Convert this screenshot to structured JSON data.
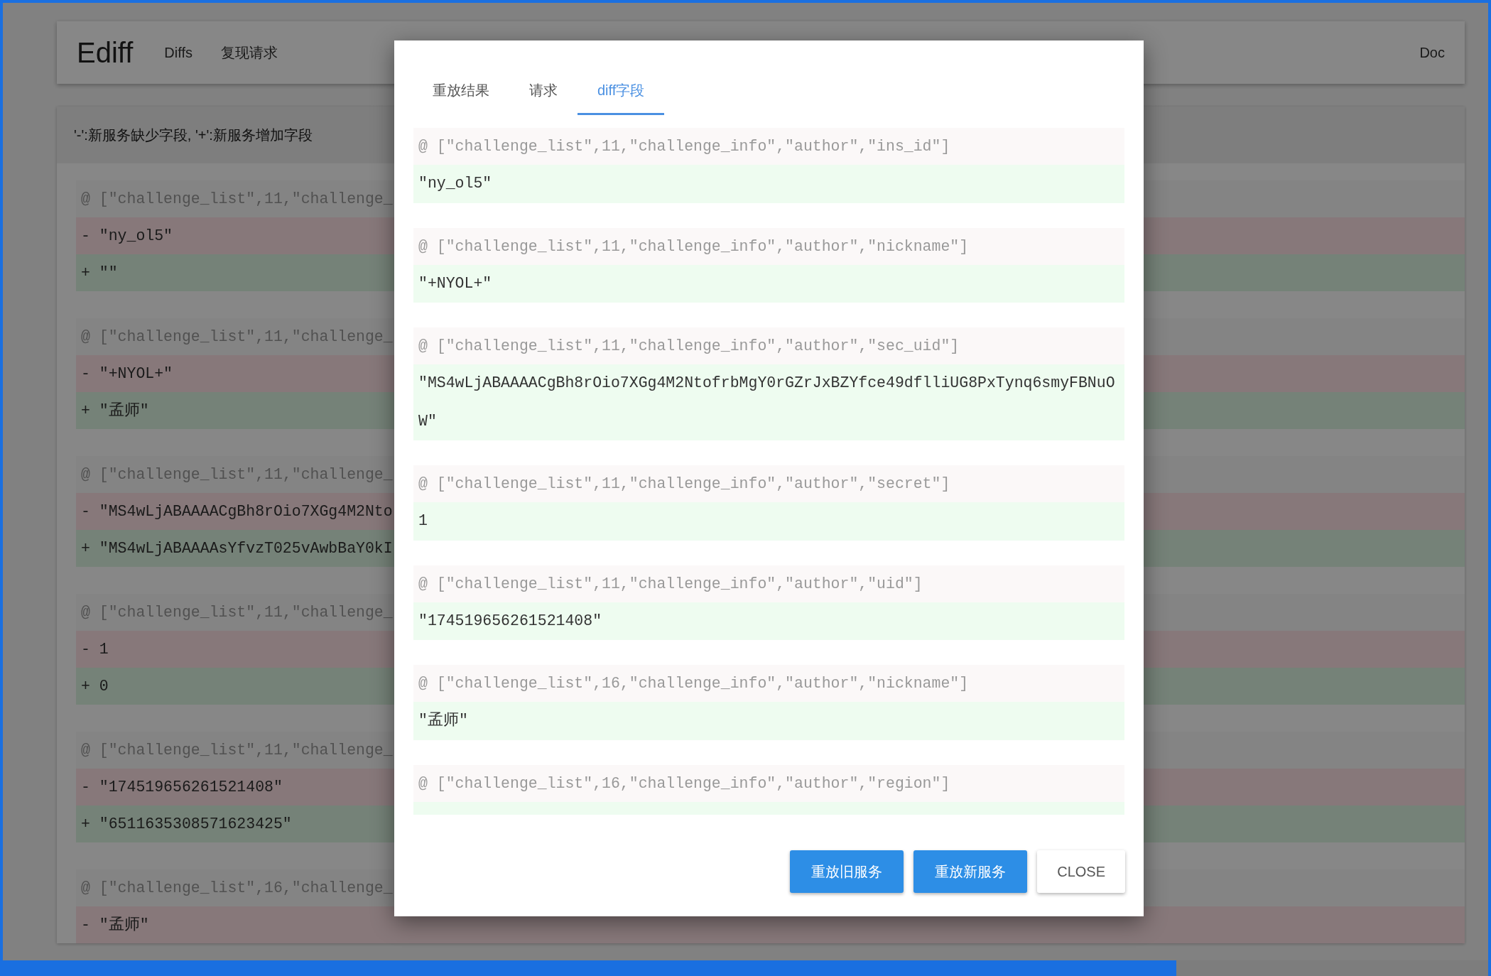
{
  "app": {
    "brand": "Ediff",
    "nav": [
      "Diffs",
      "复现请求"
    ],
    "doc_link": "Doc"
  },
  "legend": "'-':新服务缺少字段, '+':新服务增加字段",
  "diffs": [
    {
      "lines": [
        {
          "kind": "path",
          "text": "@ [\"challenge_list\",11,\"challenge_"
        },
        {
          "kind": "removed",
          "text": "- \"ny_ol5\""
        },
        {
          "kind": "added",
          "text": "+ \"\""
        }
      ]
    },
    {
      "lines": [
        {
          "kind": "path",
          "text": "@ [\"challenge_list\",11,\"challenge_"
        },
        {
          "kind": "removed",
          "text": "- \"+NYOL+\""
        },
        {
          "kind": "added",
          "text": "+ \"孟师\""
        }
      ]
    },
    {
      "lines": [
        {
          "kind": "path",
          "text": "@ [\"challenge_list\",11,\"challenge_"
        },
        {
          "kind": "removed",
          "text": "- \"MS4wLjABAAAACgBh8rOio7XGg4M2Nto"
        },
        {
          "kind": "added",
          "text": "+ \"MS4wLjABAAAAsYfvzT025vAwbBaY0kI"
        }
      ]
    },
    {
      "lines": [
        {
          "kind": "path",
          "text": "@ [\"challenge_list\",11,\"challenge_"
        },
        {
          "kind": "removed",
          "text": "- 1"
        },
        {
          "kind": "added",
          "text": "+ 0"
        }
      ]
    },
    {
      "lines": [
        {
          "kind": "path",
          "text": "@ [\"challenge_list\",11,\"challenge_"
        },
        {
          "kind": "removed",
          "text": "- \"174519656261521408\""
        },
        {
          "kind": "added",
          "text": "+ \"6511635308571623425\""
        }
      ]
    },
    {
      "lines": [
        {
          "kind": "path",
          "text": "@ [\"challenge_list\",16,\"challenge_"
        },
        {
          "kind": "removed",
          "text": "- \"孟师\""
        }
      ]
    }
  ],
  "modal": {
    "tabs": [
      {
        "label": "重放结果",
        "selected": false
      },
      {
        "label": "请求",
        "selected": false
      },
      {
        "label": "diff字段",
        "selected": true
      }
    ],
    "entries": [
      {
        "path": "@ [\"challenge_list\",11,\"challenge_info\",\"author\",\"ins_id\"]",
        "value": "\"ny_ol5\""
      },
      {
        "path": "@ [\"challenge_list\",11,\"challenge_info\",\"author\",\"nickname\"]",
        "value": "\"+NYOL+\""
      },
      {
        "path": "@ [\"challenge_list\",11,\"challenge_info\",\"author\",\"sec_uid\"]",
        "value": "\"MS4wLjABAAAACgBh8rOio7XGg4M2NtofrbMgY0rGZrJxBZYfce49dflliUG8PxTynq6smyFBNuOW\""
      },
      {
        "path": "@ [\"challenge_list\",11,\"challenge_info\",\"author\",\"secret\"]",
        "value": "1"
      },
      {
        "path": "@ [\"challenge_list\",11,\"challenge_info\",\"author\",\"uid\"]",
        "value": "\"174519656261521408\""
      },
      {
        "path": "@ [\"challenge_list\",16,\"challenge_info\",\"author\",\"nickname\"]",
        "value": "\"孟师\""
      },
      {
        "path": "@ [\"challenge_list\",16,\"challenge_info\",\"author\",\"region\"]"
      }
    ],
    "buttons": [
      {
        "label": "重放旧服务",
        "kind": "primary"
      },
      {
        "label": "重放新服务",
        "kind": "primary"
      },
      {
        "label": "CLOSE",
        "kind": "plain"
      }
    ]
  }
}
